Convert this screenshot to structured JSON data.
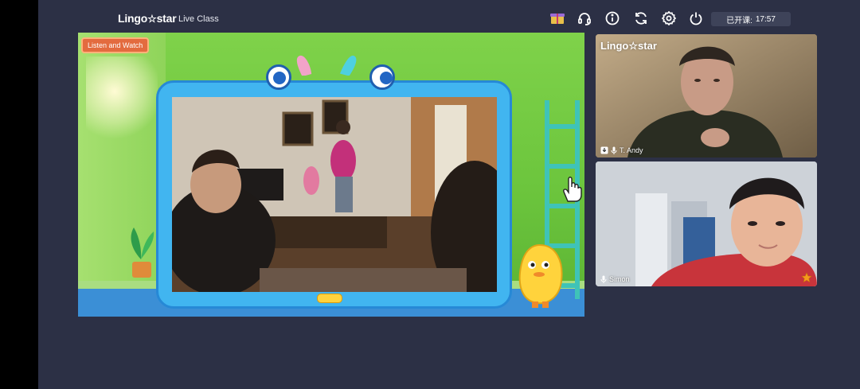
{
  "header": {
    "brand": "Lingo",
    "brand_star": "☆",
    "brand_suffix": "star",
    "subtitle": "Live Class",
    "timer_label": "已开课:",
    "timer_value": "17:57"
  },
  "toolbar": {
    "icons": [
      "gift-box-icon",
      "headset-icon",
      "info-icon",
      "refresh-icon",
      "settings-icon",
      "power-icon"
    ]
  },
  "stage": {
    "badge": "Listen and Watch"
  },
  "participants": [
    {
      "name": "T. Andy",
      "brand": "Lingo",
      "brand_star": "☆",
      "brand_suffix": "star"
    },
    {
      "name": "Simon"
    }
  ],
  "colors": {
    "background": "#2c3045",
    "stage_green": "#6cc53d",
    "frame_blue": "#41b5f0",
    "badge_orange": "#e36b3f",
    "star_orange": "#f59a1d"
  }
}
